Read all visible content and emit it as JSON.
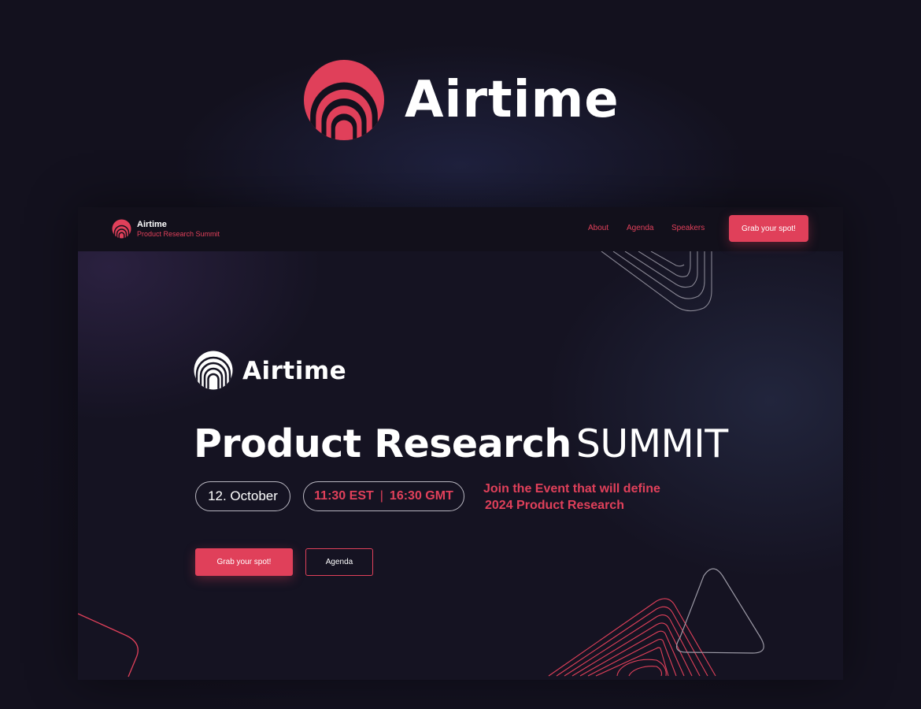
{
  "brand": {
    "name": "Airtime",
    "logo_icon": "airtime-arches-icon"
  },
  "colors": {
    "accent": "#e0405a",
    "background": "#13111e",
    "panel": "#151322",
    "text": "#ffffff",
    "outline": "#b8b6c0"
  },
  "nav": {
    "title": "Airtime",
    "subtitle": "Product Research Summit",
    "links": [
      "About",
      "Agenda",
      "Speakers"
    ],
    "cta": "Grab your spot!"
  },
  "hero": {
    "brand": "Airtime",
    "headline_bold": "Product Research",
    "headline_light": "SUMMIT",
    "date": "12. October",
    "time_est": "11:30 EST",
    "time_sep": "|",
    "time_gmt": "16:30 GMT",
    "tagline_line1": "Join the Event that will define",
    "tagline_line2": "2024 Product Research",
    "primary_button": "Grab your spot!",
    "secondary_button": "Agenda"
  }
}
